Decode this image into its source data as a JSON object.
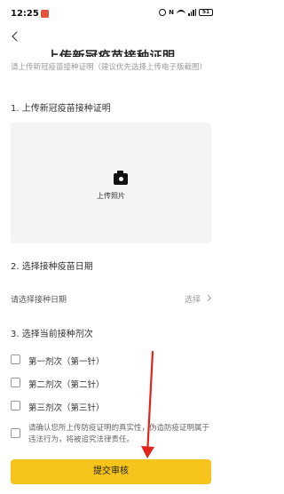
{
  "status_bar": {
    "time": "12:25",
    "battery": "51"
  },
  "nav": {
    "title": "上传新冠疫苗接种证明"
  },
  "hint": "请上传新冠疫苗接种证明（建议优先选择上传电子版截图）",
  "sections": {
    "upload": {
      "title": "1. 上传新冠疫苗接种证明",
      "upload_label": "上传照片",
      "camera_icon": "camera-icon"
    },
    "date": {
      "title": "2. 选择接种疫苗日期",
      "label": "请选择接种日期",
      "select_text": "选择"
    },
    "dose": {
      "title": "3. 选择当前接种剂次",
      "options": [
        "第一剂次（第一针）",
        "第二剂次（第二针）",
        "第三剂次（第三针）"
      ]
    }
  },
  "consent_text": "请确认您所上传防疫证明的真实性，伪造防疫证明属于违法行为，将被追究法律责任。",
  "submit_label": "提交审核",
  "colors": {
    "accent": "#f6c41a",
    "annotation_arrow": "#e0241b",
    "upload_bg": "#f4f4f4"
  }
}
